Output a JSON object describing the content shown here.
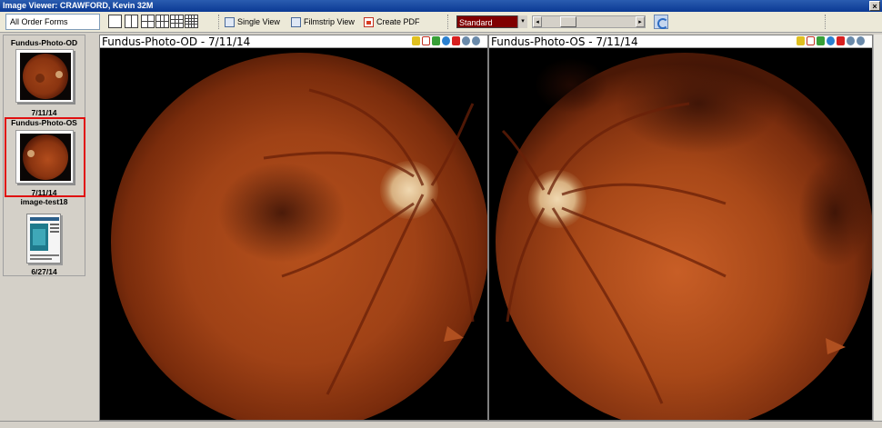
{
  "window": {
    "title": "Image Viewer: CRAWFORD, Kevin  32M",
    "close_glyph": "×"
  },
  "toolbar": {
    "order_forms": "All Order Forms",
    "single_view": "Single View",
    "filmstrip_view": "Filmstrip View",
    "create_pdf": "Create PDF",
    "preset": "Standard",
    "slider_left": "◂",
    "slider_right": "▸",
    "dropdown_glyph": "▾"
  },
  "thumbnails": [
    {
      "title": "Fundus-Photo-OD",
      "date": "7/11/14",
      "selected": false
    },
    {
      "title": "Fundus-Photo-OS",
      "date": "7/11/14",
      "selected": true
    },
    {
      "title": "image-test18",
      "date": "6/27/14",
      "selected": false
    }
  ],
  "panes": [
    {
      "title": "Fundus-Photo-OD - 7/11/14",
      "eye": "OD"
    },
    {
      "title": "Fundus-Photo-OS - 7/11/14",
      "eye": "OS"
    }
  ],
  "icons": {
    "pane_tools": [
      "pencil-icon",
      "pdf-icon",
      "download-icon",
      "info-icon",
      "delete-icon",
      "zoom-in-icon",
      "zoom-out-icon"
    ]
  },
  "colors": {
    "titlebar": "#0b3a94",
    "selection": "#e01010",
    "preset_bg": "#800000"
  }
}
